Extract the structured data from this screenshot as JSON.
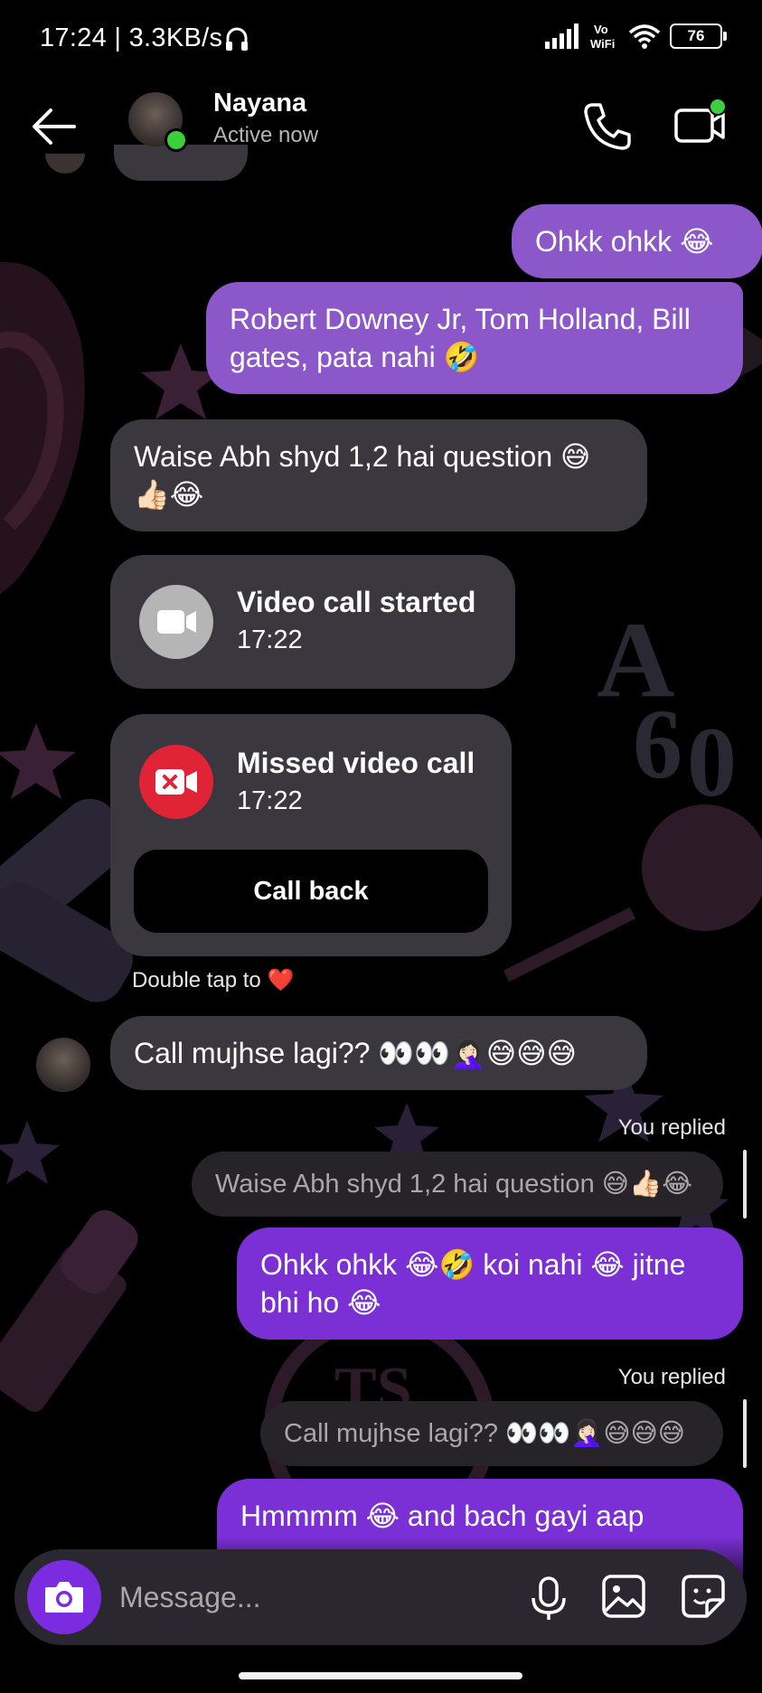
{
  "status_bar": {
    "time": "17:24 | 3.3KB/s",
    "battery": "76"
  },
  "header": {
    "contact_name": "Nayana",
    "contact_status": "Active now"
  },
  "messages": [
    {
      "type": "sent",
      "text": "Ohkk ohkk 😂"
    },
    {
      "type": "sent",
      "text": "Robert Downey Jr, Tom Holland, Bill gates, pata nahi 🤣"
    },
    {
      "type": "received",
      "text": "Waise Abh shyd 1,2 hai question 😅 👍🏻😂"
    }
  ],
  "video_call": {
    "title": "Video call started",
    "time": "17:22"
  },
  "missed_call": {
    "title": "Missed video call",
    "time": "17:22",
    "button": "Call back"
  },
  "hint": "Double tap to ❤️",
  "received_2": "Call mujhse lagi?? 👀👀🤦🏻‍♀️😅😅😅",
  "replies": [
    {
      "label": "You replied",
      "preview": "Waise Abh shyd 1,2 hai question 😅👍🏻😂",
      "text": "Ohkk ohkk 😂🤣 koi nahi 😂 jitne bhi ho 😂"
    },
    {
      "label": "You replied",
      "preview": "Call mujhse lagi?? 👀👀🤦🏻‍♀️😅😅😅",
      "text": "Hmmmm 😂 and bach gayi aap"
    }
  ],
  "composer": {
    "placeholder": "Message..."
  },
  "colors": {
    "sent_bubble": "#8b57c9",
    "sent_bubble_dark": "#7a30d4",
    "received_bubble": "#3b373f",
    "accent": "#7b2be0",
    "missed_red": "#e02336",
    "online_green": "#3ccf3c"
  }
}
